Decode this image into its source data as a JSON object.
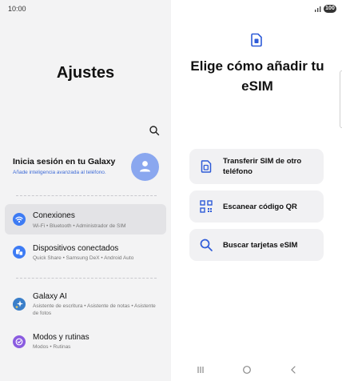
{
  "status_bar": {
    "time": "10:00",
    "battery": "100",
    "signal_icon": "signal-bars-icon"
  },
  "settings": {
    "title": "Ajustes",
    "search_icon": "search-icon",
    "account": {
      "title": "Inicia sesión en tu Galaxy",
      "subtitle": "Añade inteligencia avanzada al teléfono.",
      "avatar_icon": "person-icon"
    },
    "items": [
      {
        "title": "Conexiones",
        "subtitle": "Wi-Fi  •  Bluetooth  •  Administrador de SIM",
        "icon": "wifi-icon",
        "color": "#3d7bf4",
        "selected": true
      },
      {
        "title": "Dispositivos conectados",
        "subtitle": "Quick Share  •  Samsung DeX  •  Android Auto",
        "icon": "devices-icon",
        "color": "#3d7bf4",
        "selected": false
      },
      {
        "title": "Galaxy AI",
        "subtitle": "Asistente de escritura  •  Asistente de notas  •  Asistente de fotos",
        "icon": "sparkle-icon",
        "color": "#3a7ec9",
        "selected": false
      },
      {
        "title": "Modos y rutinas",
        "subtitle": "Modos  •  Rutinas",
        "icon": "check-circle-icon",
        "color": "#8a5be0",
        "selected": false
      }
    ]
  },
  "esim": {
    "title": "Elige cómo añadir tu eSIM",
    "header_icon": "esim-card-icon",
    "options": [
      {
        "label": "Transferir SIM de otro teléfono",
        "icon": "sim-transfer-icon"
      },
      {
        "label": "Escanear código QR",
        "icon": "qr-code-icon"
      },
      {
        "label": "Buscar tarjetas eSIM",
        "icon": "search-icon"
      }
    ],
    "accent": "#2e5bd8"
  },
  "navigation": {
    "recents_icon": "recents-icon",
    "home_icon": "home-icon",
    "back_icon": "back-icon"
  }
}
